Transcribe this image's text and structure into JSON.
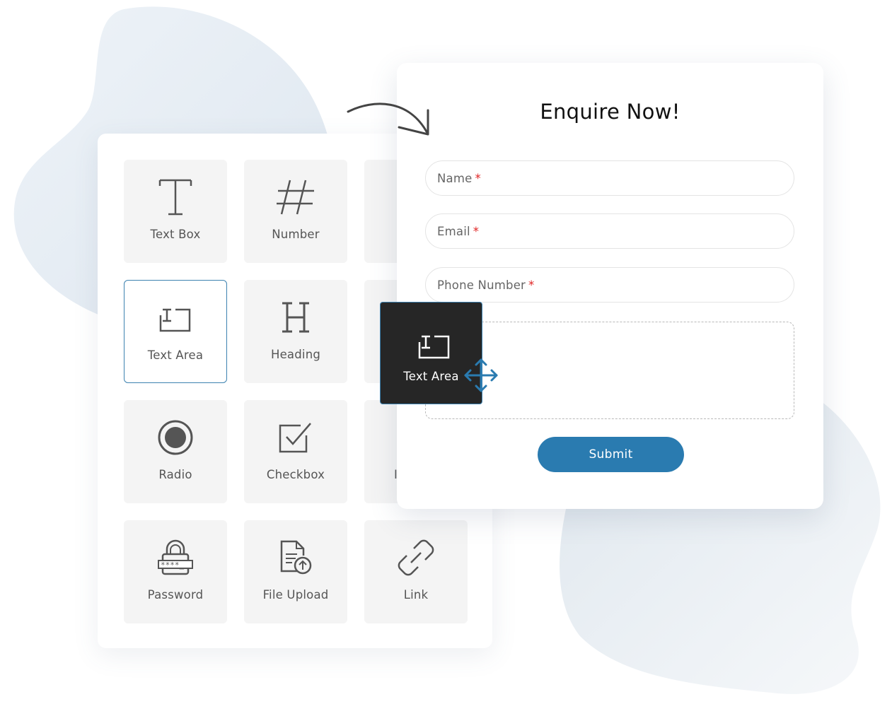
{
  "palette": {
    "tiles": [
      {
        "label": "Text Box",
        "icon": "text-box-icon"
      },
      {
        "label": "Number",
        "icon": "number-icon"
      },
      {
        "label": "",
        "icon": ""
      },
      {
        "label": "Text Area",
        "icon": "text-area-icon"
      },
      {
        "label": "Heading",
        "icon": "heading-icon"
      },
      {
        "label": "",
        "icon": ""
      },
      {
        "label": "Radio",
        "icon": "radio-icon"
      },
      {
        "label": "Checkbox",
        "icon": "checkbox-icon"
      },
      {
        "label": "I",
        "icon": ""
      },
      {
        "label": "Password",
        "icon": "password-icon"
      },
      {
        "label": "File Upload",
        "icon": "file-upload-icon"
      },
      {
        "label": "Link",
        "icon": "link-icon"
      }
    ]
  },
  "form": {
    "title": "Enquire Now!",
    "fields": [
      {
        "label": "Name",
        "required": "*"
      },
      {
        "label": "Email",
        "required": "*"
      },
      {
        "label": "Phone Number",
        "required": "*"
      }
    ],
    "submit_label": "Submit"
  },
  "drag": {
    "label": "Text Area",
    "icon": "text-area-icon",
    "cursor_icon": "move-cursor-icon"
  },
  "colors": {
    "accent": "#2a7bb0",
    "required": "#e02424",
    "drag_tile_bg": "#262626",
    "tile_bg": "#f4f4f4"
  }
}
